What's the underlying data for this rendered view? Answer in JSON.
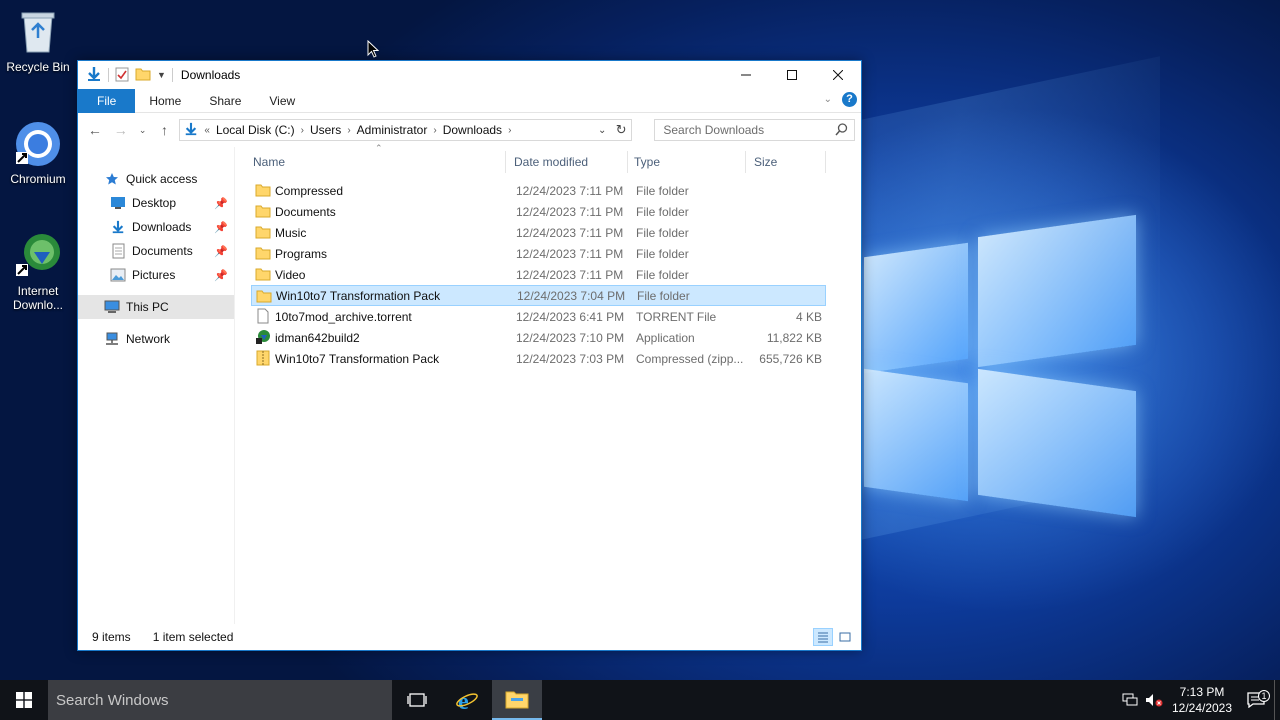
{
  "desktop": {
    "icons": [
      {
        "label": "Recycle Bin",
        "icon": "recycle-bin-icon"
      },
      {
        "label": "Chromium",
        "icon": "chromium-icon"
      },
      {
        "label": "Internet Downlo...",
        "icon": "internet-download-manager-icon"
      }
    ]
  },
  "window": {
    "title": "Downloads",
    "ribbon_tabs": [
      "File",
      "Home",
      "Share",
      "View"
    ],
    "breadcrumb": [
      "Local Disk (C:)",
      "Users",
      "Administrator",
      "Downloads"
    ],
    "search_placeholder": "Search Downloads",
    "nav": [
      {
        "label": "Quick access",
        "icon": "star-icon",
        "level": 0,
        "pinned": false
      },
      {
        "label": "Desktop",
        "icon": "desktop-icon",
        "level": 1,
        "pinned": true
      },
      {
        "label": "Downloads",
        "icon": "download-arrow-icon",
        "level": 1,
        "pinned": true
      },
      {
        "label": "Documents",
        "icon": "documents-icon",
        "level": 1,
        "pinned": true
      },
      {
        "label": "Pictures",
        "icon": "pictures-icon",
        "level": 1,
        "pinned": true
      },
      {
        "label": "This PC",
        "icon": "computer-icon",
        "level": 0,
        "pinned": false,
        "selected": true
      },
      {
        "label": "Network",
        "icon": "network-icon",
        "level": 0,
        "pinned": false
      }
    ],
    "columns": {
      "name": "Name",
      "date": "Date modified",
      "type": "Type",
      "size": "Size"
    },
    "files": [
      {
        "name": "Compressed",
        "date": "12/24/2023 7:11 PM",
        "type": "File folder",
        "size": "",
        "icon": "folder"
      },
      {
        "name": "Documents",
        "date": "12/24/2023 7:11 PM",
        "type": "File folder",
        "size": "",
        "icon": "folder"
      },
      {
        "name": "Music",
        "date": "12/24/2023 7:11 PM",
        "type": "File folder",
        "size": "",
        "icon": "folder"
      },
      {
        "name": "Programs",
        "date": "12/24/2023 7:11 PM",
        "type": "File folder",
        "size": "",
        "icon": "folder"
      },
      {
        "name": "Video",
        "date": "12/24/2023 7:11 PM",
        "type": "File folder",
        "size": "",
        "icon": "folder"
      },
      {
        "name": "Win10to7 Transformation Pack",
        "date": "12/24/2023 7:04 PM",
        "type": "File folder",
        "size": "",
        "icon": "folder",
        "selected": true
      },
      {
        "name": "10to7mod_archive.torrent",
        "date": "12/24/2023 6:41 PM",
        "type": "TORRENT File",
        "size": "4 KB",
        "icon": "file"
      },
      {
        "name": "idman642build2",
        "date": "12/24/2023 7:10 PM",
        "type": "Application",
        "size": "11,822 KB",
        "icon": "app"
      },
      {
        "name": "Win10to7 Transformation Pack",
        "date": "12/24/2023 7:03 PM",
        "type": "Compressed (zipp...",
        "size": "655,726 KB",
        "icon": "zip"
      }
    ],
    "status": {
      "items": "9 items",
      "selected": "1 item selected"
    }
  },
  "taskbar": {
    "search_placeholder": "Search Windows",
    "time": "7:13 PM",
    "date": "12/24/2023",
    "notification_count": "1"
  },
  "colors": {
    "accent": "#1979ca",
    "selection": "#cce8ff",
    "folder": "#ffd66b"
  }
}
